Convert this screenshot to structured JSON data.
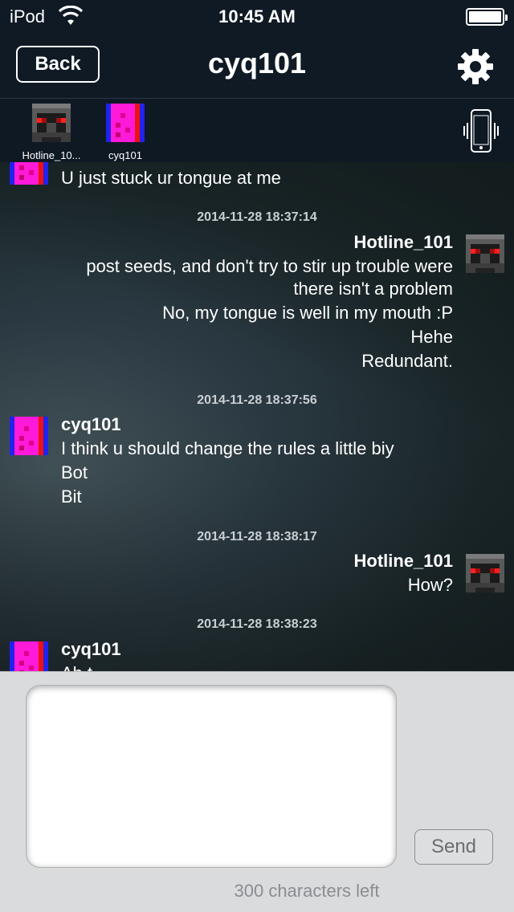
{
  "status_bar": {
    "carrier": "iPod",
    "time": "10:45 AM"
  },
  "nav": {
    "back_label": "Back",
    "title": "cyq101"
  },
  "participants": [
    {
      "name": "Hotline_10..."
    },
    {
      "name": "cyq101"
    }
  ],
  "messages": {
    "m0": {
      "lines": [
        "U just stuck ur tongue at me"
      ]
    },
    "m1": {
      "timestamp": "2014-11-28 18:37:14",
      "sender": "Hotline_101",
      "lines": [
        "post seeds, and don't try to stir up trouble were",
        "there isn't a problem",
        "No, my tongue is well in my mouth :P",
        "Hehe",
        "Redundant."
      ]
    },
    "m2": {
      "timestamp": "2014-11-28 18:37:56",
      "sender": "cyq101",
      "lines": [
        "I think u should change the rules a little biy",
        "Bot",
        "Bit"
      ]
    },
    "m3": {
      "timestamp": "2014-11-28 18:38:17",
      "sender": "Hotline_101",
      "lines": [
        "How?"
      ]
    },
    "m4": {
      "timestamp": "2014-11-28 18:38:23",
      "sender": "cyq101",
      "lines": [
        "Ah t"
      ]
    }
  },
  "composer": {
    "input_value": "",
    "send_label": "Send",
    "chars_left": "300 characters left"
  },
  "colors": {
    "nav_bg": "#0f1a25",
    "composer_bg": "#d9dbdd",
    "avatar_magenta": "#ff1ad9",
    "avatar_red_eyes": "#ff2020"
  }
}
